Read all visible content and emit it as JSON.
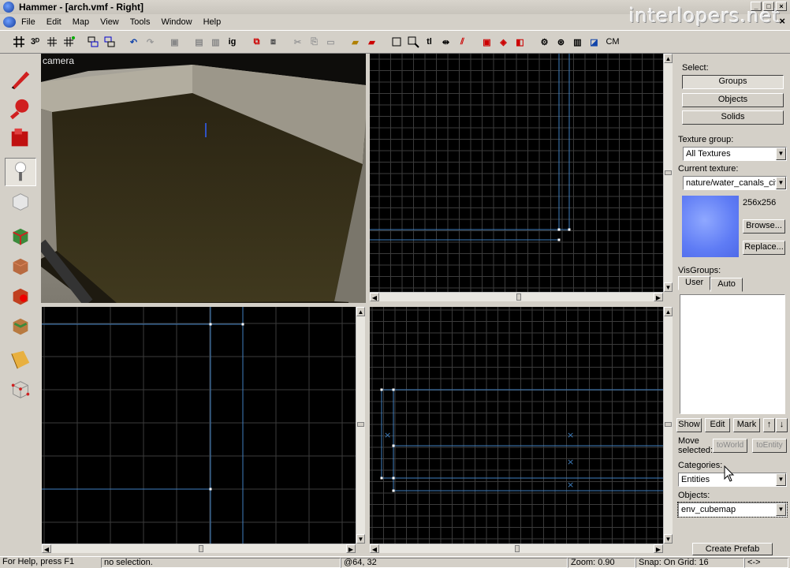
{
  "window": {
    "title": "Hammer - [arch.vmf - Right]",
    "watermark": "interlopers.net"
  },
  "menu": [
    "File",
    "Edit",
    "Map",
    "View",
    "Tools",
    "Window",
    "Help"
  ],
  "toolbar": {
    "cm_label": "CM",
    "tl_label": "tl",
    "ig_label": "ig"
  },
  "viewports": {
    "camera_label": "camera"
  },
  "right_panel": {
    "select_label": "Select:",
    "groups_btn": "Groups",
    "objects_btn": "Objects",
    "solids_btn": "Solids",
    "texture_group_label": "Texture group:",
    "texture_group_value": "All Textures",
    "current_texture_label": "Current texture:",
    "current_texture_value": "nature/water_canals_cit",
    "texture_size": "256x256",
    "browse_btn": "Browse...",
    "replace_btn": "Replace...",
    "visgroups_label": "VisGroups:",
    "tab_user": "User",
    "tab_auto": "Auto",
    "show_btn": "Show",
    "edit_btn": "Edit",
    "mark_btn": "Mark",
    "up_btn": "↑",
    "down_btn": "↓",
    "move_selected_line1": "Move",
    "move_selected_line2": "selected:",
    "to_world_btn": "toWorld",
    "to_entity_btn": "toEntity",
    "categories_label": "Categories:",
    "categories_value": "Entities",
    "objects_label": "Objects:",
    "objects_value": "env_cubemap",
    "create_prefab_btn": "Create Prefab"
  },
  "status": {
    "help": "For Help, press F1",
    "selection": "no selection.",
    "coords": "@64, 32",
    "zoom": "Zoom: 0.90",
    "snap": "Snap: On Grid: 16",
    "extra": "<->"
  },
  "colors": {
    "grid": "#3b3b3b",
    "brush_line": "#3f7fc0",
    "texture_swatch": "#6a86f5"
  }
}
